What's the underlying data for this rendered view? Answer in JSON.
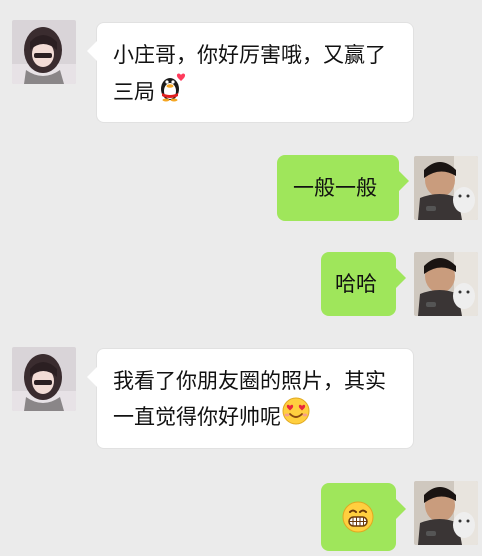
{
  "conversation": {
    "messages": [
      {
        "sender": "other",
        "line1": "小庄哥，你好厉害哦，又赢了",
        "line2": "三局",
        "emoji": "qq-penguin-with-heart"
      },
      {
        "sender": "self",
        "text": "一般一般"
      },
      {
        "sender": "self",
        "text": "哈哈"
      },
      {
        "sender": "other",
        "line1": "我看了你朋友圈的照片，其实",
        "line2": "一直觉得你好帅呢",
        "emoji": "heart-eyes-face"
      },
      {
        "sender": "self",
        "emoji": "grinning-teeth-face"
      }
    ]
  },
  "colors": {
    "background": "#ebebeb",
    "incoming_bubble": "#ffffff",
    "outgoing_bubble": "#9fe65b"
  }
}
